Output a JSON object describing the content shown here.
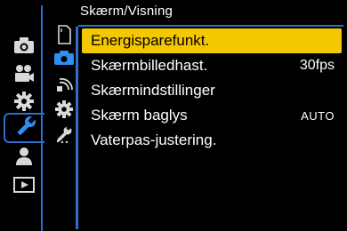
{
  "header": {
    "title": "Skærm/Visning"
  },
  "categories": [
    {
      "name": "photo-menu",
      "icon": "camera-icon",
      "active": false
    },
    {
      "name": "video-menu",
      "icon": "movie-camera-icon",
      "active": false
    },
    {
      "name": "custom-menu",
      "icon": "gear-icon",
      "active": false
    },
    {
      "name": "setup-menu",
      "icon": "wrench-icon",
      "active": true
    },
    {
      "name": "my-menu",
      "icon": "person-icon",
      "active": false
    },
    {
      "name": "playback-menu",
      "icon": "playback-icon",
      "active": false
    }
  ],
  "subtabs": [
    {
      "name": "card-file",
      "icon": "card-icon",
      "active": false
    },
    {
      "name": "monitor-display",
      "icon": "monitor-icon",
      "active": true
    },
    {
      "name": "in-out",
      "icon": "wireless-icon",
      "active": false
    },
    {
      "name": "setting",
      "icon": "gear-small-icon",
      "active": false
    },
    {
      "name": "others",
      "icon": "wrench-small-icon",
      "active": false
    }
  ],
  "menu": {
    "items": [
      {
        "label": "Energisparefunkt.",
        "value": "",
        "selected": true
      },
      {
        "label": "Skærmbilledhast.",
        "value": "30fps",
        "selected": false
      },
      {
        "label": "Skærmindstillinger",
        "value": "",
        "selected": false
      },
      {
        "label": "Skærm baglys",
        "value": "AUTO",
        "selected": false
      },
      {
        "label": "Vaterpas-justering.",
        "value": "",
        "selected": false
      }
    ]
  },
  "colors": {
    "accent": "#2d6fd0",
    "highlight": "#f4c800",
    "icon": "#d8d8d8"
  }
}
